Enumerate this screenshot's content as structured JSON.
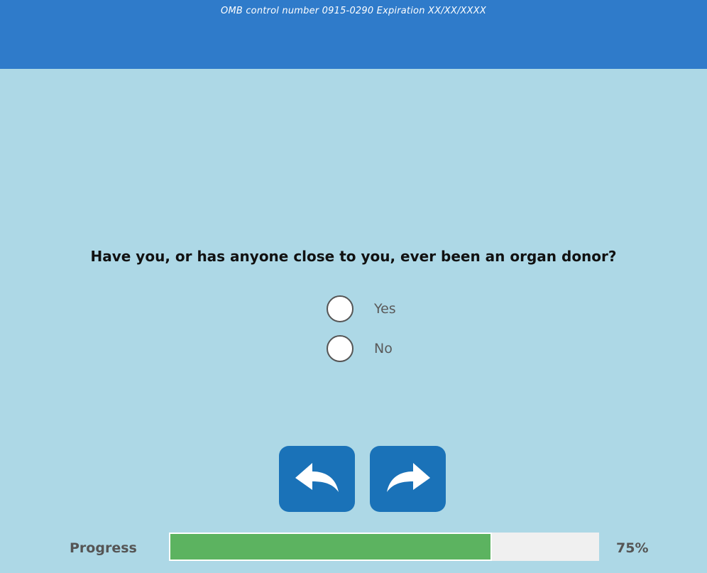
{
  "header": {
    "omb_text": "OMB control number 0915-0290 Expiration XX/XX/XXXX",
    "color": "#2f7bca"
  },
  "question": {
    "text": "Have you, or has anyone close to you, ever been an organ donor?",
    "options": [
      {
        "label": "Yes",
        "selected": false
      },
      {
        "label": "No",
        "selected": false
      }
    ]
  },
  "navigation": {
    "back_icon": "back-arrow-icon",
    "next_icon": "forward-arrow-icon",
    "button_color": "#1a72b8"
  },
  "progress": {
    "label": "Progress",
    "percent_text": "75%",
    "fraction": 0.75,
    "fill_color": "#5cb360"
  },
  "colors": {
    "background": "#add8e6"
  }
}
